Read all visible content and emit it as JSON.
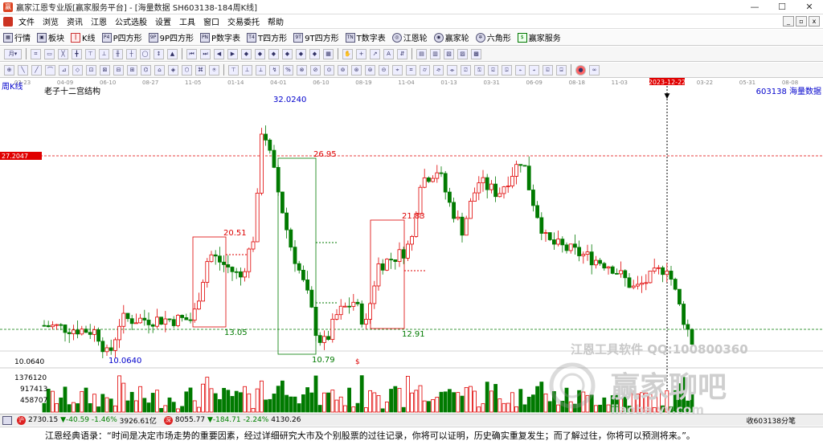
{
  "window": {
    "title": "赢家江恩专业版[赢家服务平台] - [海量数据  SH603138-184周K线]",
    "app_icon": "赢"
  },
  "menu": [
    "文件",
    "浏览",
    "资讯",
    "江恩",
    "公式选股",
    "设置",
    "工具",
    "窗口",
    "交易委托",
    "帮助"
  ],
  "nav": [
    {
      "label": "行情",
      "icon": "grid-icon"
    },
    {
      "label": "板块",
      "icon": "blocks-icon"
    },
    {
      "label": "K线",
      "icon": "candle-icon"
    },
    {
      "label": "P四方形",
      "icon": "P4"
    },
    {
      "label": "9P四方形",
      "icon": "9P"
    },
    {
      "label": "P数字表",
      "icon": "PN"
    },
    {
      "label": "T四方形",
      "icon": "T4"
    },
    {
      "label": "9T四方形",
      "icon": "9T"
    },
    {
      "label": "T数字表",
      "icon": "TN"
    },
    {
      "label": "江恩轮",
      "icon": "wheel-icon"
    },
    {
      "label": "赢家轮",
      "icon": "wheel-icon"
    },
    {
      "label": "六角形",
      "icon": "hex-icon"
    },
    {
      "label": "赢家服务",
      "icon": "dollar-icon"
    }
  ],
  "chart": {
    "period_label": "周K线",
    "structure_label": "老子十二宫结构",
    "stock_label": "603138  海量数据",
    "date_ticks": [
      "03-23",
      "04-09",
      "06-10",
      "08-27",
      "11-05",
      "01-14",
      "04-01",
      "06-10",
      "08-19",
      "11-04",
      "01-13",
      "03-31",
      "06-09",
      "08-18",
      "11-03",
      "2023-12-22",
      "03-22",
      "05-31",
      "08-08"
    ],
    "price_marker": "27.2047",
    "low_label": "10.0640",
    "annotations": [
      "32.0240",
      "26.95",
      "20.51",
      "13.05",
      "21.83",
      "12.91",
      "10.79",
      "10.0640",
      "$"
    ],
    "volume_ticks": [
      "1376120",
      "917413",
      "458707"
    ],
    "watermark_top": "江恩工具软件  QQ:100800360",
    "watermark_main": "赢家聊吧",
    "watermark_sub": "jiaoba.yy.com",
    "colors": {
      "up": "#e00000",
      "down": "#007a00",
      "price_marker": "#e00000"
    }
  },
  "chart_data": {
    "type": "candlestick",
    "y_price_range": [
      10.06,
      32.02
    ],
    "key_levels": {
      "high": 32.024,
      "low": 10.064,
      "marker": 27.2047,
      "box1_top": 20.51,
      "box1_bottom": 13.05,
      "box2_top": 21.83,
      "box2_bottom": 12.91,
      "box3_top": 26.95,
      "box3_bottom": 10.79
    },
    "volume_labels": [
      1376120,
      917413,
      458707
    ]
  },
  "status": {
    "sh_value": "2730.15",
    "sh_change": "▼-40.59",
    "sh_pct": "-1.46%",
    "sh_amount": "3926.61亿",
    "sz_value": "8055.77",
    "sz_change": "▼-184.71",
    "sz_pct": "-2.24%",
    "sz_amount": "4130.26",
    "right_text": "收603138分笔"
  },
  "quote": "江恩经典语录：“时间是决定市场走势的重要因素，经过详细研究大市及个别股票的过往记录，你将可以证明，历史确实重复发生；而了解过往，你将可以预测将来。”。"
}
